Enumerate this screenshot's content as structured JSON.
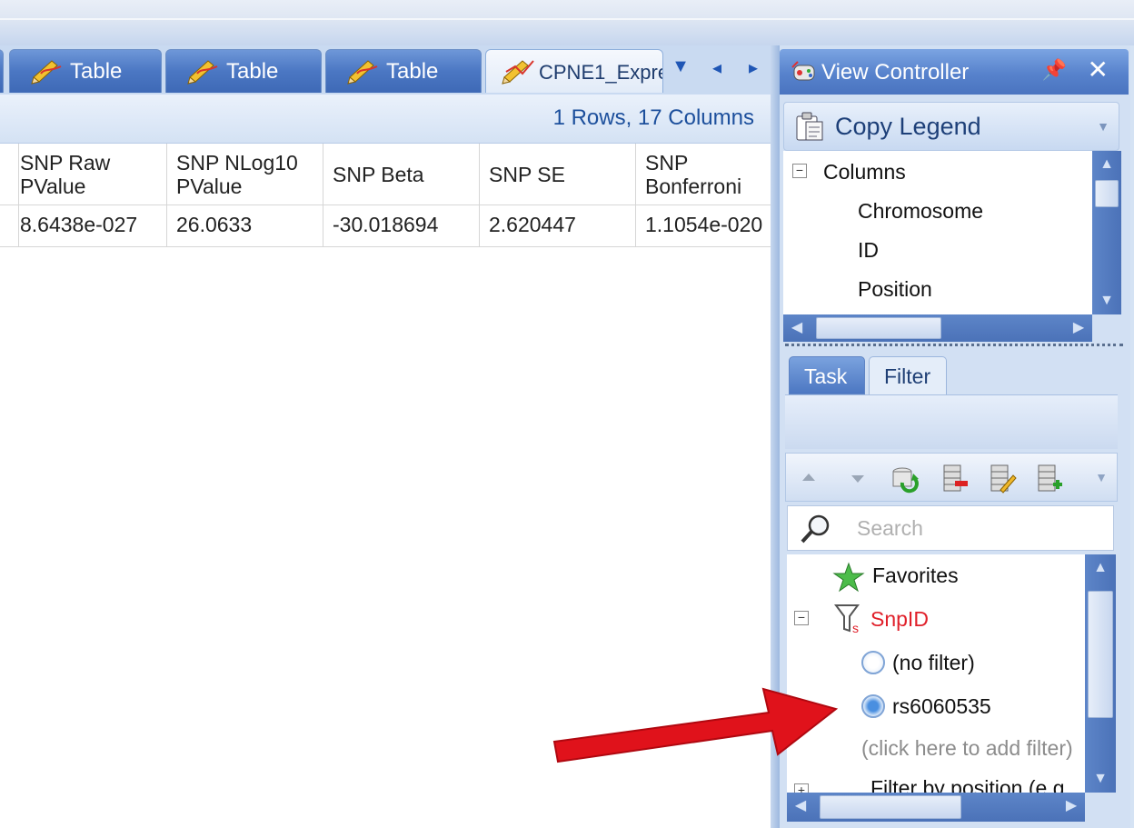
{
  "tabs": [
    {
      "label": "Table",
      "active": false
    },
    {
      "label": "Table",
      "active": false
    },
    {
      "label": "Table",
      "active": false
    },
    {
      "label": "CPNE1_Expre",
      "active": true
    }
  ],
  "info": {
    "summary": "1 Rows, 17 Columns"
  },
  "grid": {
    "columns": [
      {
        "line1": "SNP Raw",
        "line2": "PValue"
      },
      {
        "line1": "SNP NLog10",
        "line2": "PValue"
      },
      {
        "line1": "SNP Beta",
        "line2": ""
      },
      {
        "line1": "SNP SE",
        "line2": ""
      },
      {
        "line1": "SNP",
        "line2": "Bonferroni"
      }
    ],
    "rows": [
      [
        "8.6438e-027",
        "26.0633",
        "-30.018694",
        "2.620447",
        "1.1054e-020"
      ]
    ]
  },
  "view_controller": {
    "title": "View Controller",
    "pin_icon": "pin-icon",
    "close_icon": "close-icon",
    "copy_legend": "Copy Legend",
    "columns_tree": {
      "root": "Columns",
      "items": [
        "Chromosome",
        "ID",
        "Position"
      ]
    },
    "panel_tabs": {
      "task": "Task",
      "filter": "Filter"
    },
    "search_placeholder": "Search",
    "filters": {
      "favorites": "Favorites",
      "snp_group": "SnpID",
      "options": [
        "(no filter)",
        "rs6060535"
      ],
      "selected_option": "rs6060535",
      "add_hint": "(click here to add filter)",
      "next_group_partial": "Filter by position (e.g."
    }
  },
  "colors": {
    "accent": "#4a74c0",
    "filter_name": "#e0202a",
    "arrow": "#e0121b"
  }
}
